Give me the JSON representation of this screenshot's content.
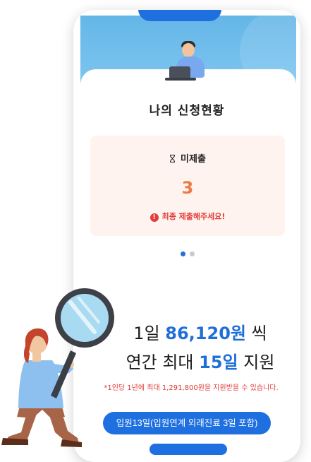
{
  "status_panel": {
    "title": "나의 신청현황",
    "status_label": "미제출",
    "count": "3",
    "warning": "최종 제출해주세요!",
    "carousel": {
      "total": 2,
      "active": 1
    }
  },
  "promo": {
    "line1_prefix": "1일 ",
    "line1_amount": "86,120원",
    "line1_suffix": " 씩",
    "line2_prefix": "연간 최대 ",
    "line2_days": "15일",
    "line2_suffix": " 지원",
    "footnote": "*1인당 1년에 최대 1,291,800원을 지원받을 수 있습니다.",
    "cta_label": "입원13일(입원연계 외래진료 3일 포함)"
  },
  "colors": {
    "accent_blue": "#1f6fd8",
    "count_orange": "#ed7b45",
    "warning_red": "#e23b3b",
    "card_bg": "#fff3ef"
  },
  "icons": {
    "status": "hourglass-icon",
    "warning": "exclamation-icon",
    "illustration": "magnifier-person-illustration"
  }
}
